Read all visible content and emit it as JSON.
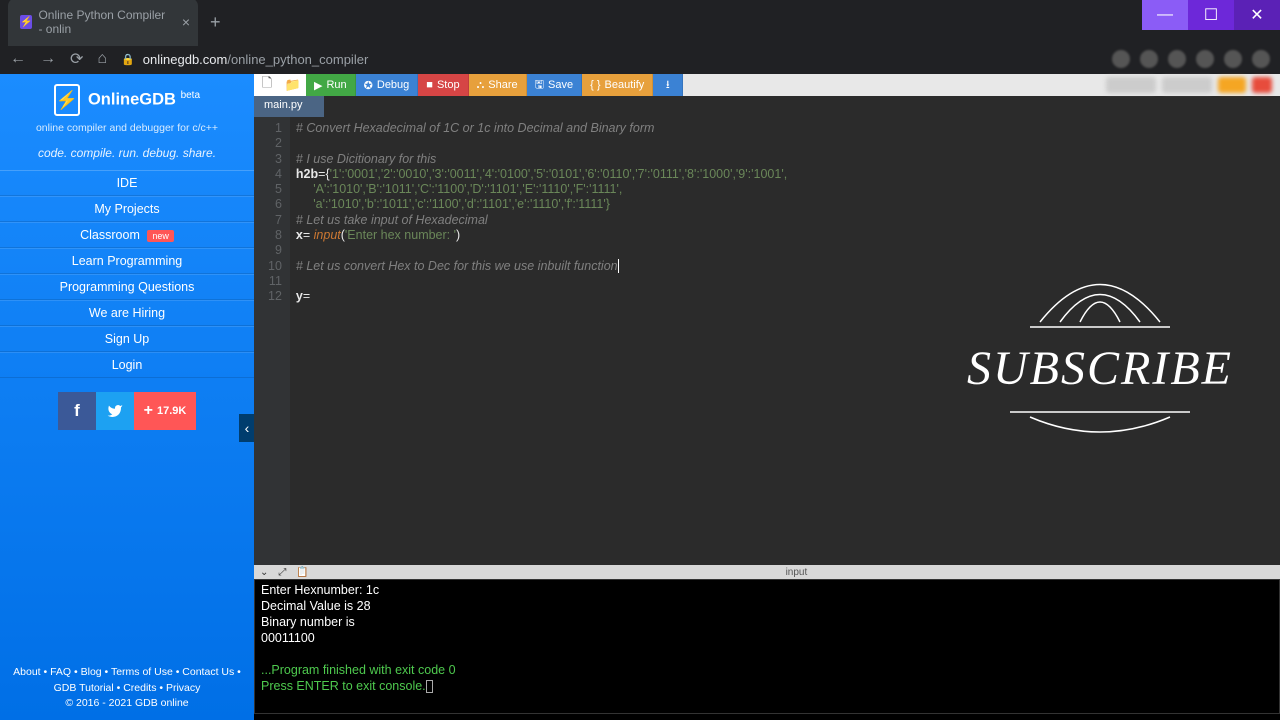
{
  "browser": {
    "tab_title": "Online Python Compiler - onlin",
    "url_domain": "onlinegdb.com",
    "url_path": "/online_python_compiler"
  },
  "sidebar": {
    "logo_text": "OnlineGDB",
    "logo_beta": "beta",
    "subtitle": "online compiler and debugger for c/c++",
    "tagline": "code. compile. run. debug. share.",
    "items": [
      "IDE",
      "My Projects",
      "Classroom",
      "Learn Programming",
      "Programming Questions",
      "We are Hiring",
      "Sign Up",
      "Login"
    ],
    "badge_new": "new",
    "share_count": "17.9K",
    "footer_line1": "About • FAQ • Blog • Terms of Use • Contact Us • GDB Tutorial • Credits • Privacy",
    "footer_line2": "© 2016 - 2021 GDB online"
  },
  "toolbar": {
    "run": "Run",
    "debug": "Debug",
    "stop": "Stop",
    "share": "Share",
    "save": "Save",
    "beautify": "Beautify"
  },
  "editor": {
    "filename": "main.py",
    "line_count": 12,
    "lines": {
      "l1": "# Convert Hexadecimal of 1C or 1c into Decimal and Binary form",
      "l3": "# I use Dicitionary for this",
      "l4a": "h2b",
      "l4b": "={",
      "l4c": "'1':'0001','2':'0010','3':'0011','4':'0100','5':'0101','6':'0110','7':'0111','8':'1000','9':'1001',",
      "l5": "     'A':'1010','B':'1011','C':'1100','D':'1101','E':'1110','F':'1111',",
      "l6": "     'a':'1010','b':'1011','c':'1100','d':'1101','e':'1110','f':'1111'}",
      "l7": "# Let us take input of Hexadecimal",
      "l8a": "x",
      "l8b": "= ",
      "l8c": "input",
      "l8d": "(",
      "l8e": "'Enter hex number: '",
      "l8f": ")",
      "l10": "# Let us convert Hex to Dec for this we use inbuilt function",
      "l12a": "y",
      "l12b": "="
    }
  },
  "overlay": {
    "text": "SUBSCRIBE"
  },
  "console": {
    "label": "input",
    "l1": "Enter Hexnumber: 1c",
    "l2": "Decimal Value is 28",
    "l3": "Binary number is",
    "l4": "00011100",
    "l5": "",
    "l6": "...Program finished with exit code 0",
    "l7": "Press ENTER to exit console."
  }
}
